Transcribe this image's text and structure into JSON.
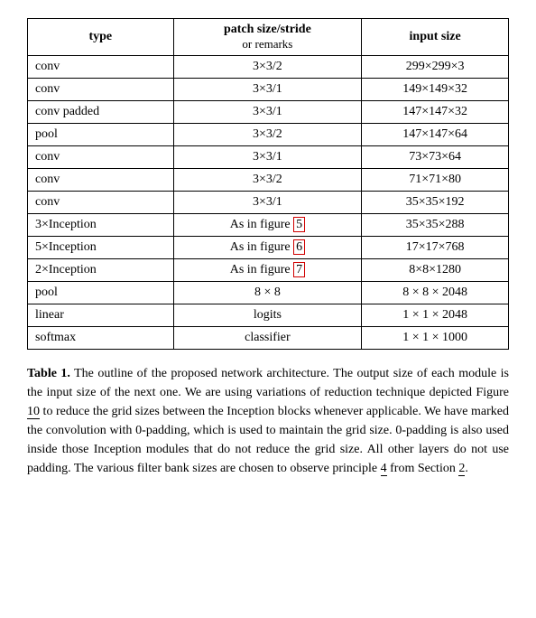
{
  "table": {
    "headers": {
      "col1": "type",
      "col2_main": "patch size/stride",
      "col2_sub": "or remarks",
      "col3": "input size"
    },
    "rows": [
      {
        "type": "conv",
        "patch": "3×3/2",
        "input": "299×299×3"
      },
      {
        "type": "conv",
        "patch": "3×3/1",
        "input": "149×149×32"
      },
      {
        "type": "conv padded",
        "patch": "3×3/1",
        "input": "147×147×32"
      },
      {
        "type": "pool",
        "patch": "3×3/2",
        "input": "147×147×64"
      },
      {
        "type": "conv",
        "patch": "3×3/1",
        "input": "73×73×64"
      },
      {
        "type": "conv",
        "patch": "3×3/2",
        "input": "71×71×80"
      },
      {
        "type": "conv",
        "patch": "3×3/1",
        "input": "35×35×192"
      },
      {
        "type": "3×Inception",
        "patch": "As in figure 5",
        "input": "35×35×288",
        "highlight": "5"
      },
      {
        "type": "5×Inception",
        "patch": "As in figure 6",
        "input": "17×17×768",
        "highlight": "6"
      },
      {
        "type": "2×Inception",
        "patch": "As in figure 7",
        "input": "8×8×1280",
        "highlight": "7"
      },
      {
        "type": "pool",
        "patch": "8 × 8",
        "input": "8 × 8 × 2048"
      },
      {
        "type": "linear",
        "patch": "logits",
        "input": "1 × 1 × 2048"
      },
      {
        "type": "softmax",
        "patch": "classifier",
        "input": "1 × 1 × 1000"
      }
    ]
  },
  "caption": {
    "bold_part": "Table 1.",
    "text": " The outline of the proposed network architecture. The output size of each module is the input size of the next one. We are using variations of reduction technique depicted Figure ",
    "link1": "10",
    "text2": " to reduce the grid sizes between the Inception blocks whenever applicable. We have marked the convolution with 0-padding, which is used to maintain the grid size. 0-padding is also used inside those Inception modules that do not reduce the grid size. All other layers do not use padding. The various filter bank sizes are chosen to observe principle ",
    "link2": "4",
    "text3": " from Section ",
    "link3": "2",
    "text4": "."
  }
}
